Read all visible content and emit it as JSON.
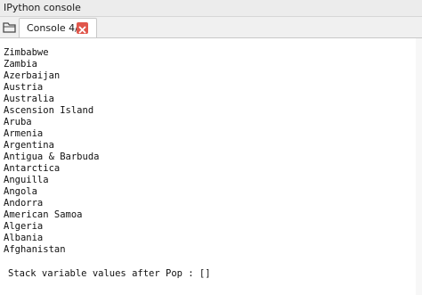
{
  "window": {
    "title": "IPython console"
  },
  "tabs": [
    {
      "label": "Console 4/A",
      "active": true,
      "close_icon": "close-icon"
    }
  ],
  "toolbar": {
    "folder_icon": "folder-icon"
  },
  "console": {
    "lines": [
      "Zimbabwe",
      "Zambia",
      "Azerbaijan",
      "Austria",
      "Australia",
      "Ascension Island",
      "Aruba",
      "Armenia",
      "Argentina",
      "Antigua & Barbuda",
      "Antarctica",
      "Anguilla",
      "Angola",
      "Andorra",
      "American Samoa",
      "Algeria",
      "Albania",
      "Afghanistan"
    ],
    "stack_message": "Stack variable values after Pop : []"
  },
  "colors": {
    "close_button": "#e0564b",
    "titlebar_bg": "#ececec",
    "tabbar_bg": "#f0f0f0"
  }
}
